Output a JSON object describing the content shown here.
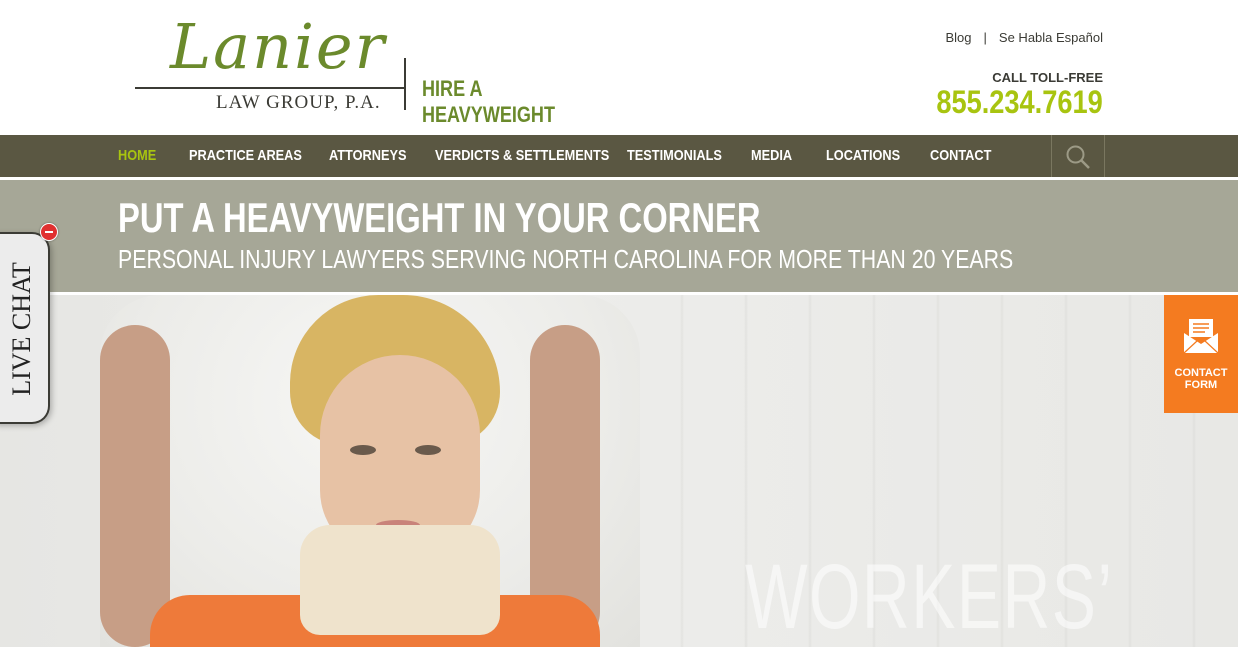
{
  "header": {
    "logo_script": "Lanier",
    "logo_subtitle": "LAW GROUP, P.A.",
    "tagline": "HIRE A HEAVYWEIGHT",
    "blog_link": "Blog",
    "separator": "|",
    "spanish_link": "Se Habla Español",
    "call_label": "CALL TOLL-FREE",
    "phone": "855.234.7619"
  },
  "nav": {
    "items": [
      {
        "label": "HOME",
        "active": true
      },
      {
        "label": "PRACTICE AREAS"
      },
      {
        "label": "ATTORNEYS"
      },
      {
        "label": "VERDICTS & SETTLEMENTS"
      },
      {
        "label": "TESTIMONIALS"
      },
      {
        "label": "MEDIA"
      },
      {
        "label": "LOCATIONS"
      },
      {
        "label": "CONTACT"
      }
    ],
    "search_icon": "search-icon"
  },
  "banner": {
    "headline": "PUT A HEAVYWEIGHT IN YOUR CORNER",
    "subheadline": "PERSONAL INJURY LAWYERS SERVING NORTH CAROLINA FOR MORE THAN 20 YEARS"
  },
  "hero": {
    "overlay_text": "WORKERS’"
  },
  "live_chat": {
    "label": "LIVE CHAT"
  },
  "contact_form": {
    "line1": "CONTACT",
    "line2": "FORM",
    "icon": "envelope-icon"
  },
  "colors": {
    "accent_green": "#a8c410",
    "nav_bg": "#5a5742",
    "banner_bg": "#a6a797",
    "contact_orange": "#f47b20"
  }
}
